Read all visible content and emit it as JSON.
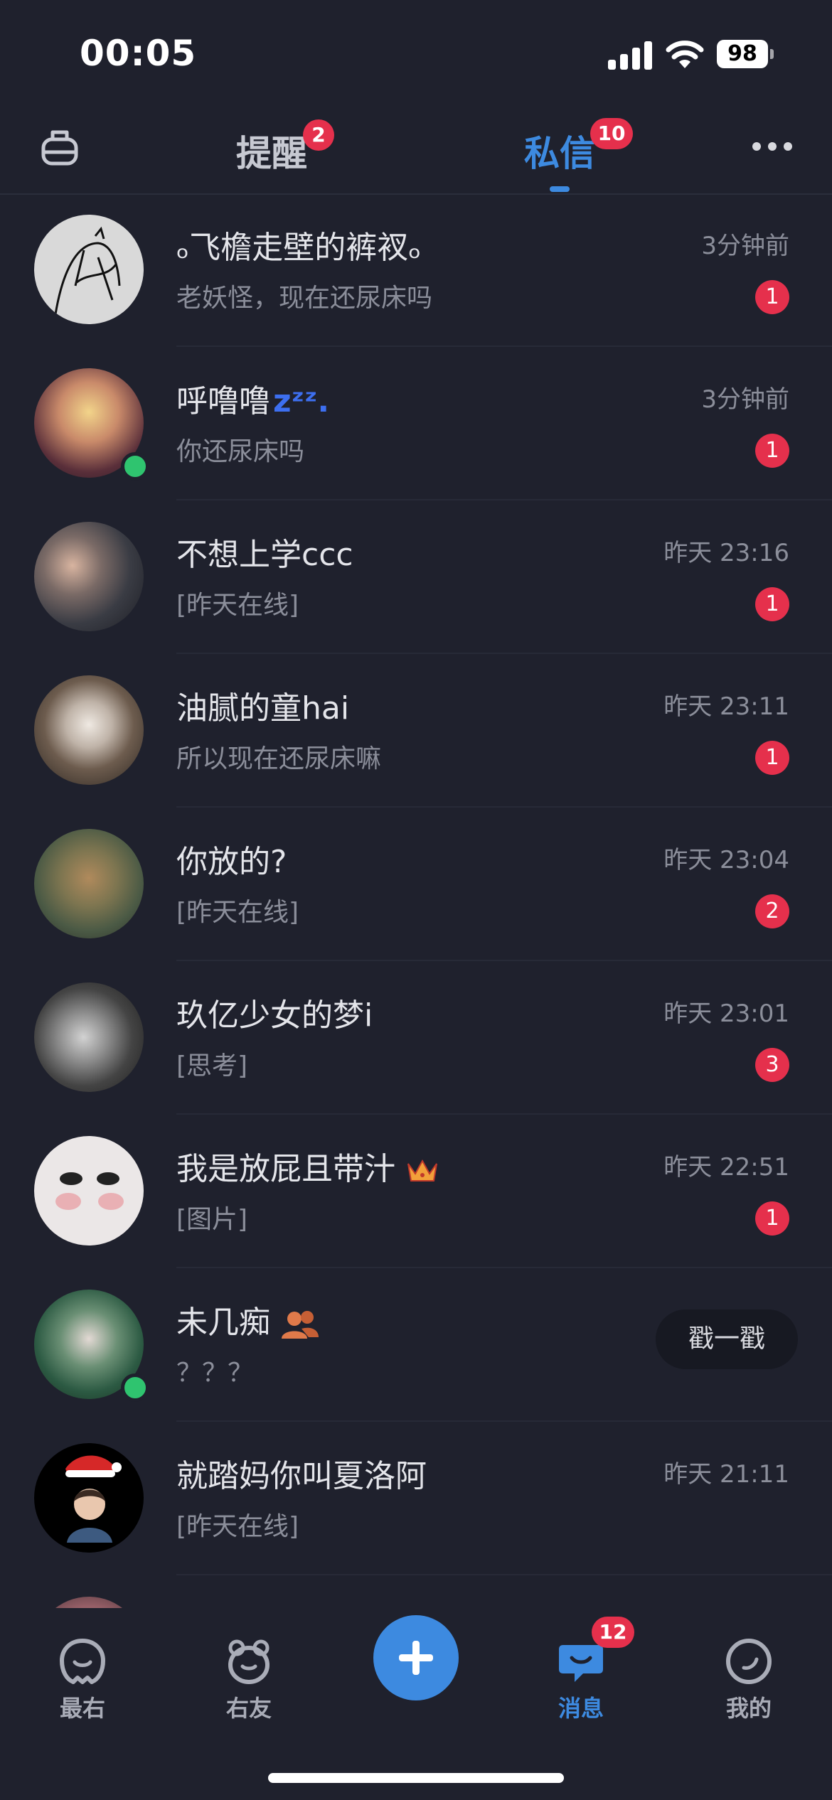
{
  "status_bar": {
    "time": "00:05",
    "battery": "98"
  },
  "top_nav": {
    "tabs": [
      {
        "label": "提醒",
        "badge": "2"
      },
      {
        "label": "私信",
        "badge": "10",
        "active": true
      }
    ]
  },
  "chats": [
    {
      "name": "ₒ飞檐走壁的裤衩ₒ",
      "preview": "老妖怪，现在还尿床吗",
      "time": "3分钟前",
      "unread": "1"
    },
    {
      "name": "呼噜噜",
      "name_suffix": "zᶻᶻ.",
      "preview": "你还尿床吗",
      "time": "3分钟前",
      "unread": "1"
    },
    {
      "name": "不想上学ccc",
      "preview": "[昨天在线]",
      "time": "昨天 23:16",
      "unread": "1"
    },
    {
      "name": "油腻的童hai",
      "preview": "所以现在还尿床嘛",
      "time": "昨天 23:11",
      "unread": "1"
    },
    {
      "name": "你放的?",
      "preview": "[昨天在线]",
      "time": "昨天 23:04",
      "unread": "2"
    },
    {
      "name": "玖亿少女的梦i",
      "preview": "[思考]",
      "time": "昨天 23:01",
      "unread": "3"
    },
    {
      "name": "我是放屁且带汁",
      "preview": "[图片]",
      "time": "昨天 22:51",
      "unread": "1"
    },
    {
      "name": "未几痴",
      "preview": "？？？",
      "poke_label": "戳一戳"
    },
    {
      "name": "就踏妈你叫夏洛阿",
      "preview": "[昨天在线]",
      "time": "昨天 21:11"
    }
  ],
  "tab_bar": {
    "items": [
      {
        "label": "最右"
      },
      {
        "label": "右友"
      },
      {
        "label": "消息",
        "badge": "12",
        "active": true
      },
      {
        "label": "我的"
      }
    ]
  },
  "colors": {
    "accent": "#3d8ae0",
    "badge": "#e5304c",
    "online": "#2fc46f",
    "background": "#1f212d"
  },
  "icons": [
    "robot-icon",
    "more-icon",
    "crown-icon",
    "friends-icon",
    "plus-icon",
    "smile-face-icon",
    "bear-face-icon",
    "chat-bubble-icon",
    "profile-face-icon"
  ]
}
